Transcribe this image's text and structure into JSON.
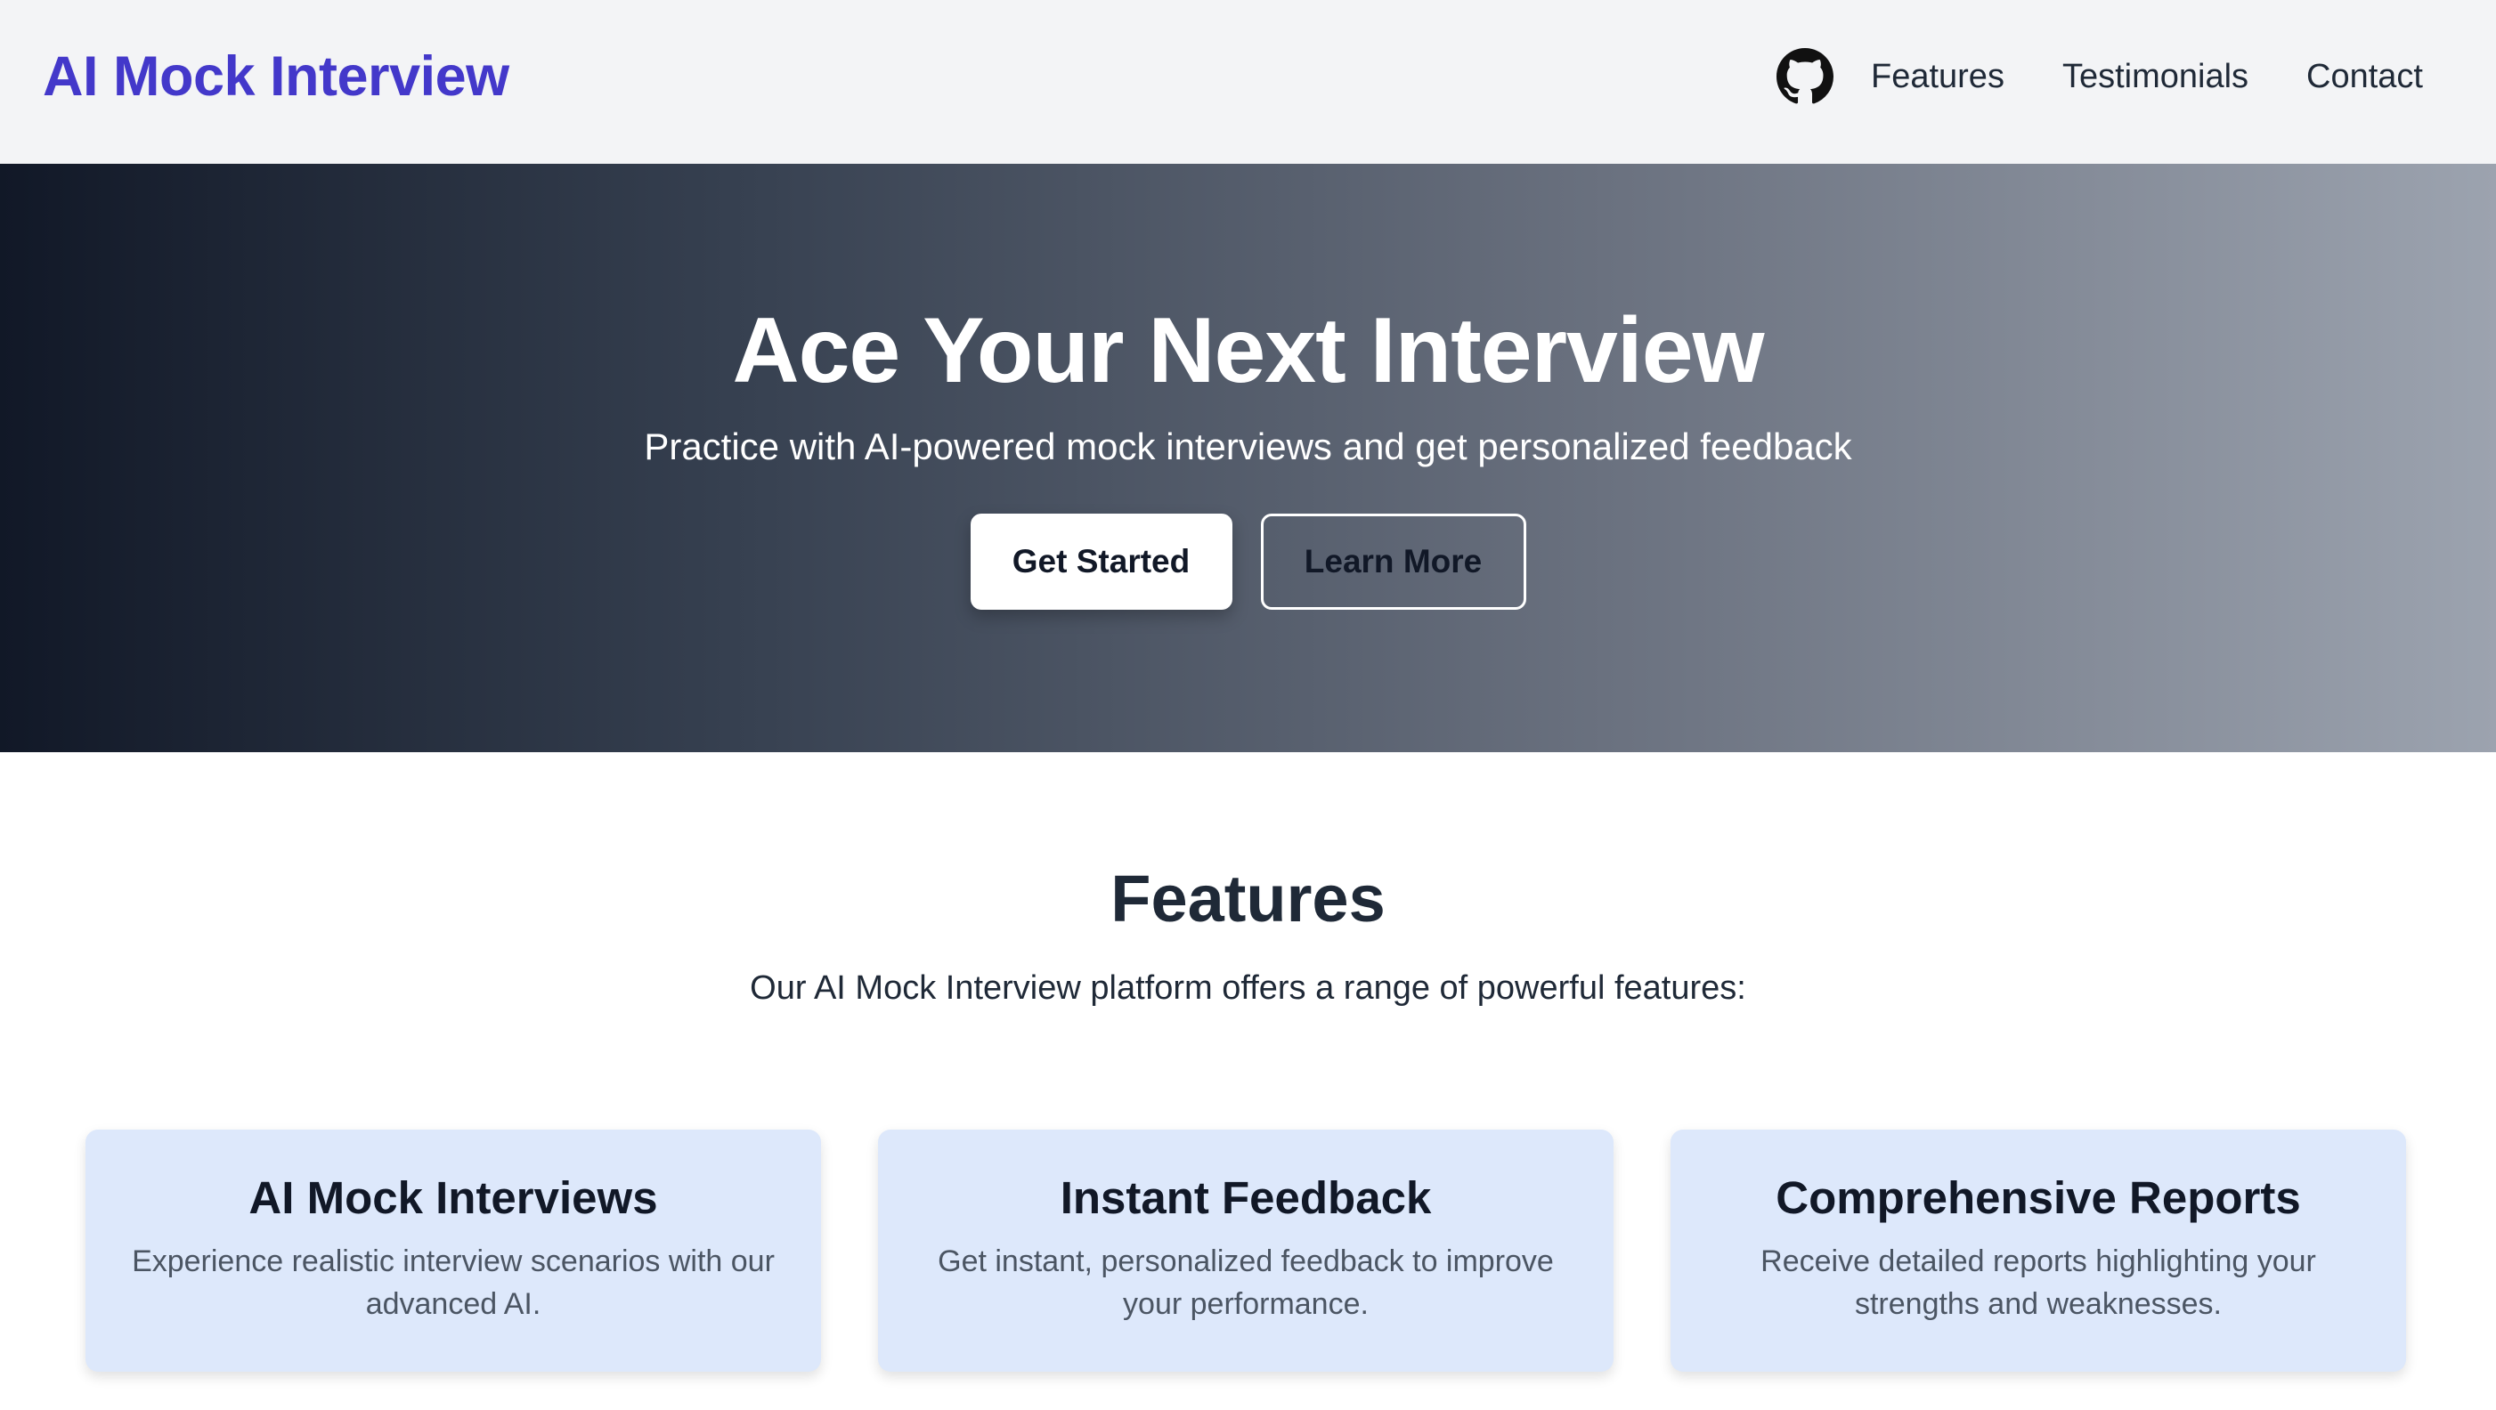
{
  "header": {
    "brand": "AI Mock Interview",
    "nav": [
      "Features",
      "Testimonials",
      "Contact"
    ],
    "github_icon": "github-icon"
  },
  "hero": {
    "title": "Ace Your Next Interview",
    "subtitle": "Practice with AI-powered mock interviews and get personalized feedback",
    "primary_button": "Get Started",
    "secondary_button": "Learn More"
  },
  "features": {
    "title": "Features",
    "subtitle": "Our AI Mock Interview platform offers a range of powerful features:",
    "cards": [
      {
        "title": "AI Mock Interviews",
        "description": "Experience realistic interview scenarios with our advanced AI."
      },
      {
        "title": "Instant Feedback",
        "description": "Get instant, personalized feedback to improve your performance."
      },
      {
        "title": "Comprehensive Reports",
        "description": "Receive detailed reports highlighting your strengths and weaknesses."
      }
    ]
  },
  "colors": {
    "brand": "#4338ca",
    "header_bg": "#f3f4f6",
    "card_bg": "#dde8fb",
    "hero_gradient_start": "#111827",
    "hero_gradient_end": "#9ca3af"
  }
}
